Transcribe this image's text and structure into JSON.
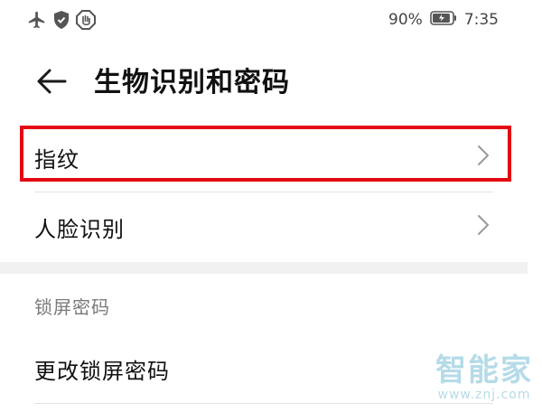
{
  "status_bar": {
    "battery_percent": "90%",
    "battery_level": 0.9,
    "time": "7:35",
    "icons": [
      "airplane-icon",
      "shield-icon",
      "hand-icon",
      "battery-icon"
    ]
  },
  "header": {
    "back_icon": "back-arrow-icon",
    "title": "生物识别和密码"
  },
  "list": {
    "items": [
      {
        "label": "指纹",
        "icon": "chevron-right-icon",
        "highlighted": true
      },
      {
        "label": "人脸识别",
        "icon": "chevron-right-icon"
      }
    ]
  },
  "lock_section": {
    "header": "锁屏密码",
    "items": [
      {
        "label": "更改锁屏密码"
      }
    ]
  },
  "watermark": {
    "text": "智能家",
    "url": "www.znj.com"
  },
  "colors": {
    "highlight": "#e30613",
    "divider": "#e3e3e3",
    "section_gap": "#f1f1f1",
    "section_header": "#7a7a7a",
    "watermark": "#b5dbe8"
  }
}
